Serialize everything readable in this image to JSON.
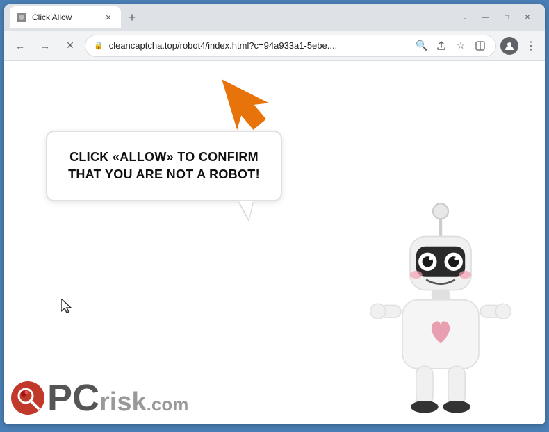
{
  "browser": {
    "tab": {
      "label": "Click Allow",
      "favicon": "🔒"
    },
    "new_tab_label": "+",
    "window_controls": {
      "chevron_down": "⌄",
      "minimize": "—",
      "maximize": "□",
      "close": "✕"
    },
    "nav": {
      "back_label": "←",
      "forward_label": "→",
      "reload_label": "✕",
      "address": "cleancaptcha.top/robot4/index.html?c=94a933a1-5ebe....",
      "lock_icon": "🔒",
      "search_icon": "🔍",
      "share_icon": "⬆",
      "bookmark_icon": "☆",
      "split_icon": "▣",
      "profile_icon": "👤",
      "menu_icon": "⋮"
    }
  },
  "page": {
    "bubble_text": "CLICK «ALLOW» TO CONFIRM THAT YOU ARE NOT A ROBOT!",
    "pcrisk_text": "PC",
    "pcrisk_risk": "risk",
    "pcrisk_com": ".com"
  },
  "icons": {
    "arrow": "orange-arrow-up-right",
    "robot": "cute-robot",
    "magnifier": "red-magnifier",
    "cursor": "mouse-cursor"
  }
}
